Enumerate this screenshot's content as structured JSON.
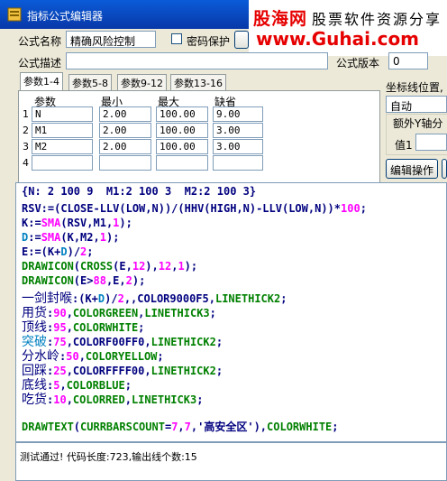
{
  "window": {
    "title": "指标公式编辑器"
  },
  "brand": {
    "name": "股海网",
    "slogan": "股票软件资源分享",
    "url": "www.Guhai.com"
  },
  "formula": {
    "name_label": "公式名称",
    "name_value": "精确风险控制",
    "password_label": "密码保护",
    "desc_label": "公式描述",
    "desc_value": "",
    "version_label": "公式版本",
    "version_value": "0"
  },
  "tabs": [
    "参数1-4",
    "参数5-8",
    "参数9-12",
    "参数13-16"
  ],
  "params": {
    "headers": [
      "参数",
      "最小",
      "最大",
      "缺省"
    ],
    "rows": [
      {
        "no": "1",
        "name": "N",
        "min": "2.00",
        "max": "100.00",
        "def": "9.00"
      },
      {
        "no": "2",
        "name": "M1",
        "min": "2.00",
        "max": "100.00",
        "def": "3.00"
      },
      {
        "no": "3",
        "name": "M2",
        "min": "2.00",
        "max": "100.00",
        "def": "3.00"
      },
      {
        "no": "4",
        "name": "",
        "min": "",
        "max": "",
        "def": ""
      }
    ]
  },
  "right_panel": {
    "axis_label": "坐标线位置,",
    "axis_value": "自动",
    "extra_axis": "额外Y轴分",
    "value1_label": "值1",
    "edit_button": "编辑操作"
  },
  "code": {
    "header": "{N: 2 100 9  M1:2 100 3  M2:2 100 3}",
    "lines": [
      [
        {
          "t": "RSV:=(CLOSE-LLV(LOW,N))/(HHV(HIGH,N)-LLV(LOW,N))*",
          "c": "#00007f"
        },
        {
          "t": "100",
          "c": "#ff00ff"
        },
        {
          "t": ";",
          "c": "#00007f"
        }
      ],
      [
        {
          "t": "K:=",
          "c": "#00007f"
        },
        {
          "t": "SMA",
          "c": "#ff00ff"
        },
        {
          "t": "(RSV,M1,",
          "c": "#00007f"
        },
        {
          "t": "1",
          "c": "#ff00ff"
        },
        {
          "t": ");",
          "c": "#00007f"
        }
      ],
      [
        {
          "t": "D",
          "c": "#0080c0"
        },
        {
          "t": ":=",
          "c": "#00007f"
        },
        {
          "t": "SMA",
          "c": "#ff00ff"
        },
        {
          "t": "(K,M2,",
          "c": "#00007f"
        },
        {
          "t": "1",
          "c": "#ff00ff"
        },
        {
          "t": ");",
          "c": "#00007f"
        }
      ],
      [
        {
          "t": "E:=(K+",
          "c": "#00007f"
        },
        {
          "t": "D",
          "c": "#0080c0"
        },
        {
          "t": ")/",
          "c": "#00007f"
        },
        {
          "t": "2",
          "c": "#ff00ff"
        },
        {
          "t": ";",
          "c": "#00007f"
        }
      ],
      [
        {
          "t": "DRAWICON",
          "c": "#008000"
        },
        {
          "t": "(",
          "c": "#00007f"
        },
        {
          "t": "CROSS",
          "c": "#008000"
        },
        {
          "t": "(E,",
          "c": "#00007f"
        },
        {
          "t": "12",
          "c": "#ff00ff"
        },
        {
          "t": "),",
          "c": "#00007f"
        },
        {
          "t": "12",
          "c": "#ff00ff"
        },
        {
          "t": ",",
          "c": "#00007f"
        },
        {
          "t": "1",
          "c": "#ff00ff"
        },
        {
          "t": ");",
          "c": "#00007f"
        }
      ],
      [
        {
          "t": "DRAWICON",
          "c": "#008000"
        },
        {
          "t": "(E>",
          "c": "#00007f"
        },
        {
          "t": "88",
          "c": "#ff00ff"
        },
        {
          "t": ",E,",
          "c": "#00007f"
        },
        {
          "t": "2",
          "c": "#ff00ff"
        },
        {
          "t": ");",
          "c": "#00007f"
        }
      ],
      [
        {
          "t": "一剑封喉",
          "c": "#00007f",
          "big": true
        },
        {
          "t": ":(K+",
          "c": "#00007f"
        },
        {
          "t": "D",
          "c": "#0080c0"
        },
        {
          "t": ")/",
          "c": "#00007f"
        },
        {
          "t": "2",
          "c": "#ff00ff"
        },
        {
          "t": ",,COLOR9000F5,",
          "c": "#00007f"
        },
        {
          "t": "LINETHICK2",
          "c": "#008000"
        },
        {
          "t": ";",
          "c": "#00007f"
        }
      ],
      [
        {
          "t": "用货",
          "c": "#00007f",
          "big": true
        },
        {
          "t": ":",
          "c": "#00007f"
        },
        {
          "t": "90",
          "c": "#ff00ff"
        },
        {
          "t": ",",
          "c": "#00007f"
        },
        {
          "t": "COLORGREEN",
          "c": "#008000"
        },
        {
          "t": ",",
          "c": "#00007f"
        },
        {
          "t": "LINETHICK3",
          "c": "#008000"
        },
        {
          "t": ";",
          "c": "#00007f"
        }
      ],
      [
        {
          "t": "顶线",
          "c": "#00007f",
          "big": true
        },
        {
          "t": ":",
          "c": "#00007f"
        },
        {
          "t": "95",
          "c": "#ff00ff"
        },
        {
          "t": ",",
          "c": "#00007f"
        },
        {
          "t": "COLORWHITE",
          "c": "#008000"
        },
        {
          "t": ";",
          "c": "#00007f"
        }
      ],
      [
        {
          "t": "突破",
          "c": "#0080c0",
          "big": true
        },
        {
          "t": ":",
          "c": "#00007f"
        },
        {
          "t": "75",
          "c": "#ff00ff"
        },
        {
          "t": ",COLORF00FF0,",
          "c": "#00007f"
        },
        {
          "t": "LINETHICK2",
          "c": "#008000"
        },
        {
          "t": ";",
          "c": "#00007f"
        }
      ],
      [
        {
          "t": "分水岭",
          "c": "#00007f",
          "big": true
        },
        {
          "t": ":",
          "c": "#00007f"
        },
        {
          "t": "50",
          "c": "#ff00ff"
        },
        {
          "t": ",",
          "c": "#00007f"
        },
        {
          "t": "COLORYELLOW",
          "c": "#008000"
        },
        {
          "t": ";",
          "c": "#00007f"
        }
      ],
      [
        {
          "t": "回踩",
          "c": "#00007f",
          "big": true
        },
        {
          "t": ":",
          "c": "#00007f"
        },
        {
          "t": "25",
          "c": "#ff00ff"
        },
        {
          "t": ",COLORFFFF00,",
          "c": "#00007f"
        },
        {
          "t": "LINETHICK2",
          "c": "#008000"
        },
        {
          "t": ";",
          "c": "#00007f"
        }
      ],
      [
        {
          "t": "底线",
          "c": "#00007f",
          "big": true
        },
        {
          "t": ":",
          "c": "#00007f"
        },
        {
          "t": "5",
          "c": "#ff00ff"
        },
        {
          "t": ",",
          "c": "#00007f"
        },
        {
          "t": "COLORBLUE",
          "c": "#008000"
        },
        {
          "t": ";",
          "c": "#00007f"
        }
      ],
      [
        {
          "t": "吃货",
          "c": "#00007f",
          "big": true
        },
        {
          "t": ":",
          "c": "#00007f"
        },
        {
          "t": "10",
          "c": "#ff00ff"
        },
        {
          "t": ",",
          "c": "#00007f"
        },
        {
          "t": "COLORRED",
          "c": "#008000"
        },
        {
          "t": ",",
          "c": "#00007f"
        },
        {
          "t": "LINETHICK3",
          "c": "#008000"
        },
        {
          "t": ";",
          "c": "#00007f"
        }
      ],
      [],
      [
        {
          "t": "DRAWTEXT",
          "c": "#008000"
        },
        {
          "t": "(",
          "c": "#00007f"
        },
        {
          "t": "CURRBARSCOUNT",
          "c": "#008000"
        },
        {
          "t": "=",
          "c": "#00007f"
        },
        {
          "t": "7",
          "c": "#ff00ff"
        },
        {
          "t": ",",
          "c": "#00007f"
        },
        {
          "t": "7",
          "c": "#ff00ff"
        },
        {
          "t": ",'高安全区'),",
          "c": "#00007f"
        },
        {
          "t": "COLORWHITE",
          "c": "#008000"
        },
        {
          "t": ";",
          "c": "#00007f"
        }
      ]
    ]
  },
  "status": {
    "message": "测试通过! 代码长度:723,输出线个数:15"
  },
  "colors": {
    "keyword": "#008000",
    "number": "#ff00ff",
    "text": "#00007f",
    "var": "#0080c0"
  }
}
